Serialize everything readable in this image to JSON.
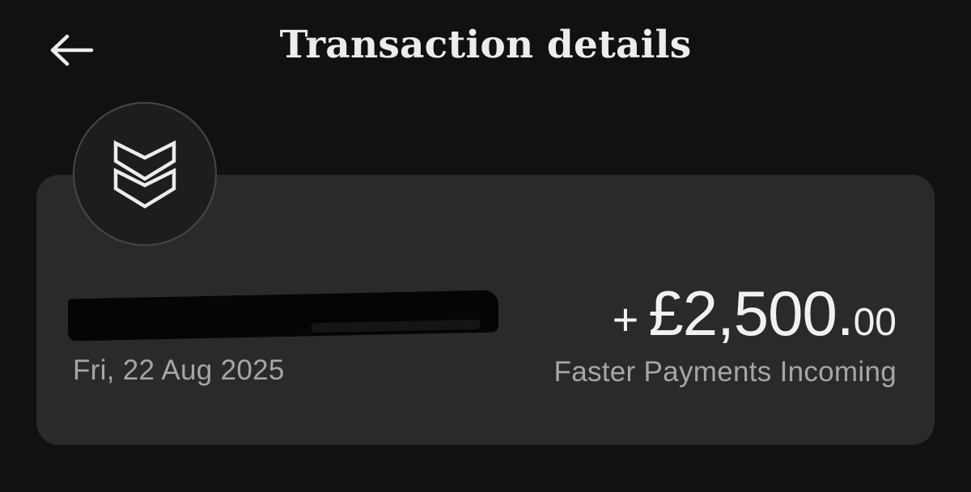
{
  "header": {
    "title": "Transaction details",
    "back_icon": "arrow-left-icon"
  },
  "transaction": {
    "merchant_logo_icon": "double-chevron-down-icon",
    "merchant_name_redacted": true,
    "date": "Fri, 22 Aug 2025",
    "amount_sign": "+",
    "amount_main": "£2,500.",
    "amount_pence": "00",
    "payment_type": "Faster Payments Incoming"
  },
  "colors": {
    "background": "#111112",
    "card": "#2a2a2c",
    "primary_text": "#ececec",
    "secondary_text": "#a6a6a8"
  }
}
